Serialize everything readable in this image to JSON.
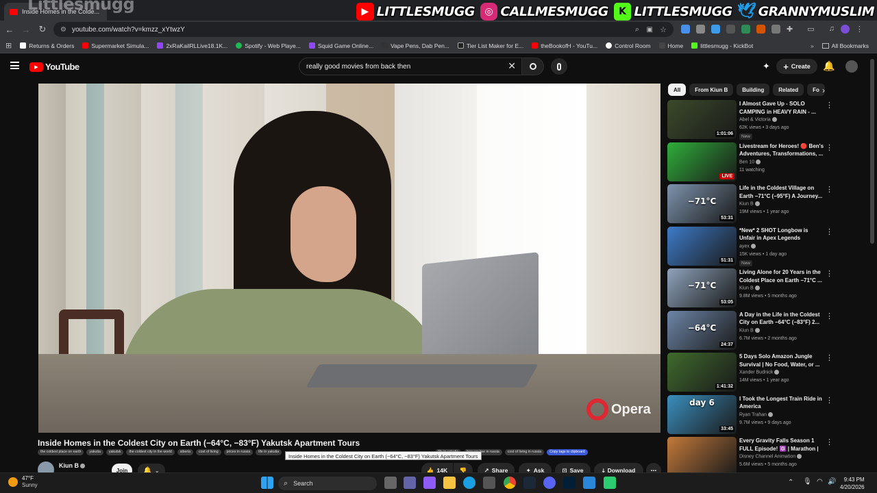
{
  "browser": {
    "tab_title": "Inside Homes in the Colde...",
    "url": "youtube.com/watch?v=kmzz_xYtwzY",
    "bookmarks": [
      "Returns & Orders",
      "Supermarket Simula...",
      "2xRaKailRLLive18.1K...",
      "Spotify - Web Playe...",
      "Squid Game Online...",
      "Vape Pens, Dab Pen...",
      "Tier List Maker for E...",
      "theBookofH - YouTu...",
      "Control Room",
      "Home",
      "littlesmugg - KickBot"
    ],
    "all_bookmarks": "All Bookmarks"
  },
  "overlay": {
    "streamer_name": "Littlesmugg",
    "socials": [
      {
        "icon": "youtube-icon",
        "handle": "LITTLESMUGG",
        "color": "#ff0000"
      },
      {
        "icon": "instagram-icon",
        "handle": "CALLMESMUGG",
        "color": "#d62976"
      },
      {
        "icon": "kick-icon",
        "handle": "LITTLESMUGG",
        "color": "#53fc18"
      },
      {
        "icon": "twitter-icon",
        "handle": "GRANNYMUSLIM",
        "color": "#1da1f2"
      }
    ]
  },
  "youtube": {
    "logo_text": "YouTube",
    "search_value": "really good movies from back then",
    "create_label": "Create",
    "video": {
      "title": "Inside Homes in the Coldest City on Earth (−64°C, −83°F) Yakutsk Apartment Tours",
      "watermark": "Opera",
      "tags": [
        "the coldest place on earth",
        "yakutia",
        "yakutsk",
        "the coldest city in the world",
        "siberia",
        "cost of living",
        "prices in russia",
        "life in yakutia",
        "",
        "",
        "",
        "life in yakutia",
        "how we live in russia",
        "cost of living in russia"
      ],
      "copy_tags_label": "Copy tags to clipboard",
      "tooltip": "Inside Homes in the Coldest City on Earth (−64°C, −83°F) Yakutsk Apartment Tours",
      "channel": "Kiun B",
      "join_label": "Join",
      "likes": "14K",
      "share_label": "Share",
      "ask_label": "Ask",
      "save_label": "Save",
      "download_label": "Download"
    },
    "chips": [
      "All",
      "From Kiun B",
      "Building",
      "Related",
      "Fo"
    ],
    "recommendations": [
      {
        "title": "I Almost Gave Up - SOLO CAMPING in HEAVY RAIN - ...",
        "channel": "Abel & Victoria",
        "meta": "62K views • 3 days ago",
        "badge": "New",
        "duration": "1:01:06",
        "thumb_color": "#3b4a2a",
        "thumb_text": ""
      },
      {
        "title": "Livestream for Heroes! 🔴 Ben's Adventures, Transformations, ...",
        "channel": "Ben 10",
        "meta": "11 watching",
        "badge": "",
        "duration": "LIVE",
        "thumb_color": "#2fae3a",
        "thumb_text": ""
      },
      {
        "title": "Life in the Coldest Village on Earth −71°C (−95°F) A Journey...",
        "channel": "Kiun B",
        "meta": "19M views • 1 year ago",
        "badge": "",
        "duration": "53:31",
        "thumb_color": "#7d93ad",
        "thumb_text": "−71°C"
      },
      {
        "title": "*New* 2 SHOT Longbow is Unfair in Apex Legends",
        "channel": "ayex",
        "meta": "15K views • 1 day ago",
        "badge": "New",
        "duration": "51:31",
        "thumb_color": "#3d7bc8",
        "thumb_text": ""
      },
      {
        "title": "Living Alone for 20 Years in the Coldest Place on Earth −71°C ...",
        "channel": "Kiun B",
        "meta": "9.8M views • 5 months ago",
        "badge": "",
        "duration": "53:05",
        "thumb_color": "#8ea3bb",
        "thumb_text": "−71°C"
      },
      {
        "title": "A Day in the Life in the Coldest City on Earth −64°C (−83°F) 2...",
        "channel": "Kiun B",
        "meta": "6.7M views • 2 months ago",
        "badge": "",
        "duration": "24:37",
        "thumb_color": "#6d86a8",
        "thumb_text": "−64°C"
      },
      {
        "title": "5 Days Solo Amazon Jungle Survival | No Food, Water, or ...",
        "channel": "Xander Budnick",
        "meta": "14M views • 1 year ago",
        "badge": "",
        "duration": "1:41:32",
        "thumb_color": "#3f6b2d",
        "thumb_text": ""
      },
      {
        "title": "I Took the Longest Train Ride in America",
        "channel": "Ryan Trahan",
        "meta": "9.7M views • 9 days ago",
        "badge": "",
        "duration": "33:45",
        "thumb_color": "#3a8fbf",
        "thumb_text": "day 6"
      },
      {
        "title": "Every Gravity Falls Season 1 FULL Episode! 🔯 | Marathon | ...",
        "channel": "Disney Channel Animation",
        "meta": "5.6M views • 5 months ago",
        "badge": "",
        "duration": "",
        "thumb_color": "#c47a3b",
        "thumb_text": ""
      }
    ]
  },
  "taskbar": {
    "temp": "47°F",
    "condition": "Sunny",
    "search_placeholder": "Search",
    "time": "9:43 PM",
    "date": "4/20/2026"
  }
}
